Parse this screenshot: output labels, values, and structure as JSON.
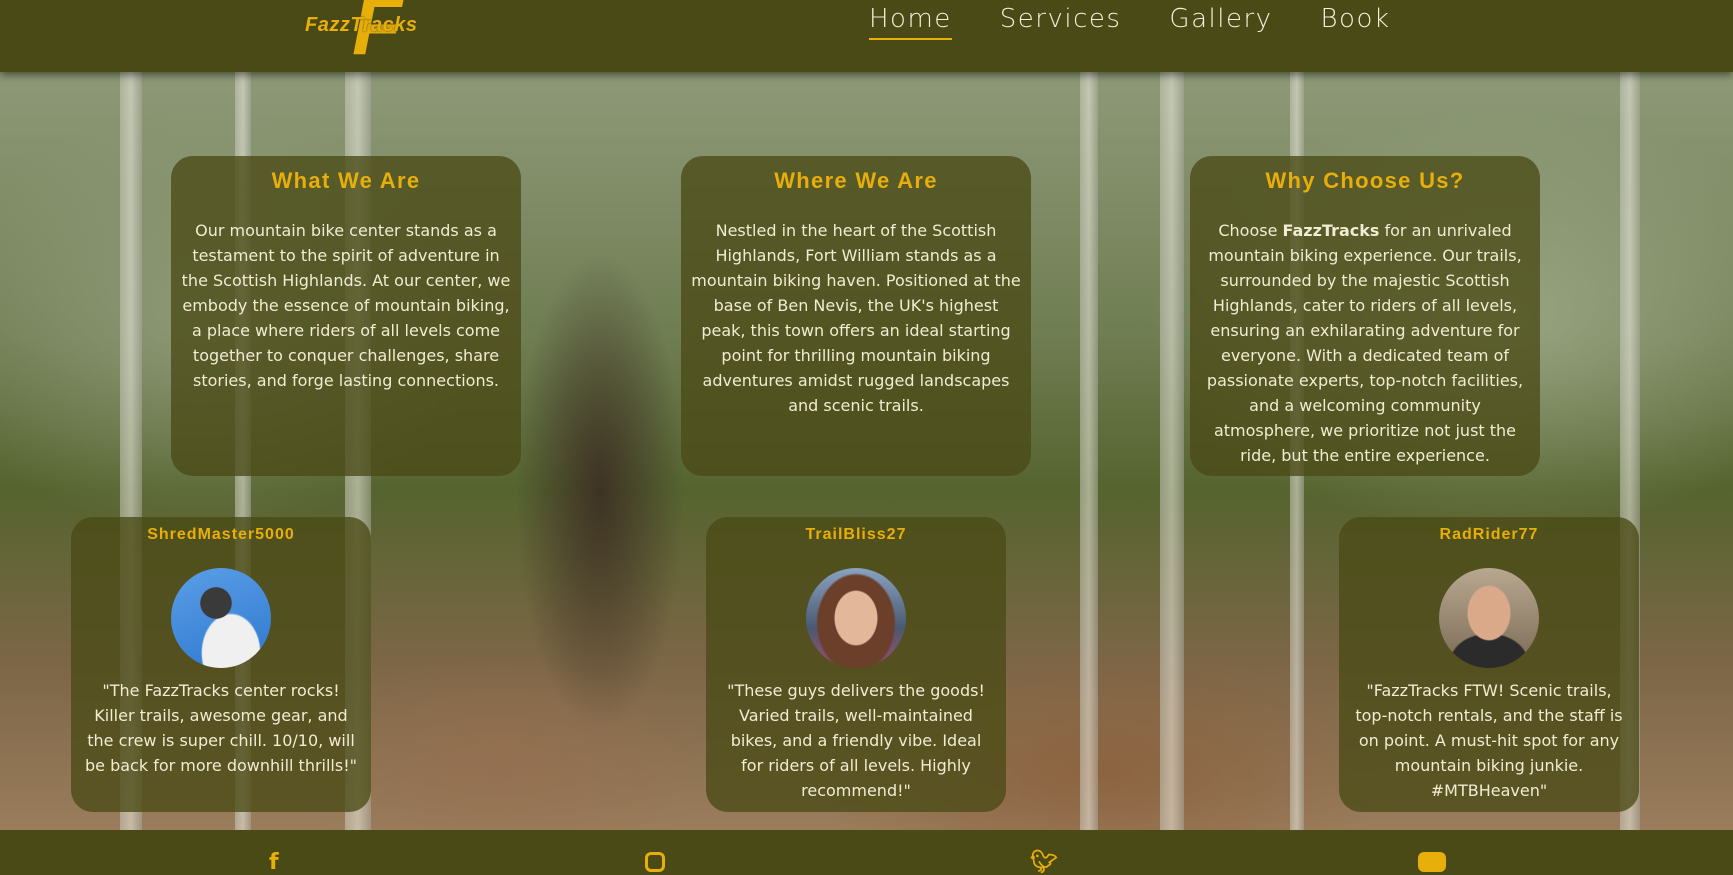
{
  "brand": {
    "name": "FazzTracks",
    "logo_letter": "F",
    "accent": "#e8ae0a",
    "bar_color": "#4a4a17"
  },
  "nav": [
    {
      "label": "Home",
      "active": true
    },
    {
      "label": "Services"
    },
    {
      "label": "Gallery"
    },
    {
      "label": "Book"
    }
  ],
  "info_cards": [
    {
      "title": "What We Are",
      "text": "Our mountain bike center stands as a testament to the spirit of adventure in the Scottish Highlands. At our center, we embody the essence of mountain biking, a place where riders of all levels come together to conquer challenges, share stories, and forge lasting connections."
    },
    {
      "title": "Where We Are",
      "text": "Nestled in the heart of the Scottish Highlands, Fort William stands as a mountain biking haven. Positioned at the base of Ben Nevis, the UK's highest peak, this town offers an ideal starting point for thrilling mountain biking adventures amidst rugged landscapes and scenic trails."
    },
    {
      "title": "Why Choose Us?",
      "text_before": "Choose ",
      "text_bold": "FazzTracks",
      "text_after": " for an unrivaled mountain biking experience. Our trails, surrounded by the majestic Scottish Highlands, cater to riders of all levels, ensuring an exhilarating adventure for everyone. With a dedicated team of passionate experts, top-notch facilities, and a welcoming community atmosphere, we prioritize not just the ride, but the entire experience."
    }
  ],
  "testimonials": [
    {
      "name": "ShredMaster5000",
      "quote": "\"The FazzTracks center rocks! Killer trails, awesome gear, and the crew is super chill. 10/10, will be back for more downhill thrills!\""
    },
    {
      "name": "TrailBliss27",
      "quote": "\"These guys delivers the goods! Varied trails, well-maintained bikes, and a friendly vibe. Ideal for riders of all levels. Highly recommend!\""
    },
    {
      "name": "RadRider77",
      "quote": "\"FazzTracks FTW! Scenic trails, top-notch rentals, and the staff is on point. A must-hit spot for any mountain biking junkie. #MTBHeaven\""
    }
  ],
  "footer": {
    "icons": [
      "facebook-icon",
      "instagram-icon",
      "twitter-icon",
      "youtube-icon"
    ]
  }
}
